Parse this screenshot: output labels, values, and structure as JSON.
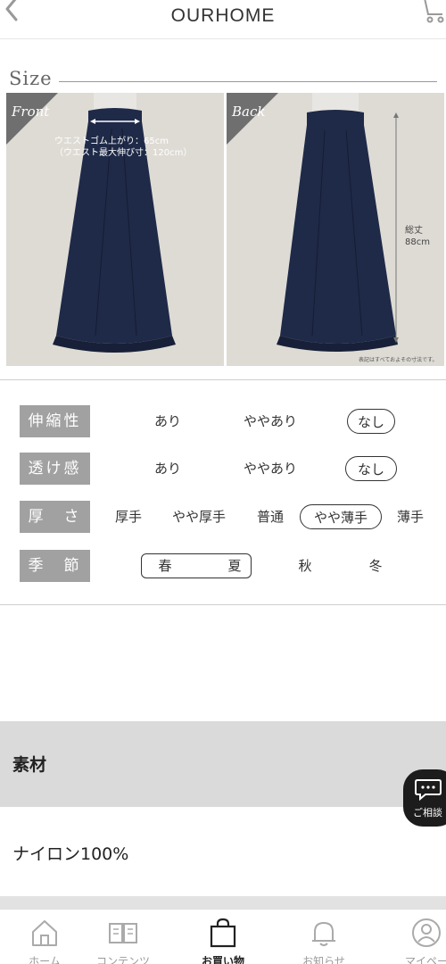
{
  "header": {
    "title": "OURHOME"
  },
  "size_section": {
    "title": "Size",
    "front": {
      "label": "Front",
      "waist_note_1": "ウエストゴム上がり：65cm",
      "waist_note_2": "（ウエスト最大伸び寸：120cm）"
    },
    "back": {
      "label": "Back",
      "length_note_1": "総丈",
      "length_note_2": "88cm",
      "disclaimer": "表記はすべておよその寸法です。"
    }
  },
  "attributes": [
    {
      "label": "伸縮性",
      "options": [
        "あり",
        "ややあり",
        "なし"
      ],
      "selected": "なし"
    },
    {
      "label": "透け感",
      "options": [
        "あり",
        "ややあり",
        "なし"
      ],
      "selected": "なし"
    },
    {
      "label": "厚　さ",
      "options": [
        "厚手",
        "やや厚手",
        "普通",
        "やや薄手",
        "薄手"
      ],
      "selected": "やや薄手"
    },
    {
      "label": "季　節",
      "options": [
        "春",
        "夏",
        "秋",
        "冬"
      ],
      "selected": "春・夏"
    }
  ],
  "material": {
    "title": "素材",
    "value": "ナイロン100%"
  },
  "chat": {
    "label": "ご相談"
  },
  "tabs": [
    {
      "label": "ホーム",
      "icon": "home-icon"
    },
    {
      "label": "コンテンツ",
      "icon": "book-icon"
    },
    {
      "label": "お買い物",
      "icon": "shopping-bag-icon",
      "active": true
    },
    {
      "label": "お知らせ",
      "icon": "bell-icon"
    },
    {
      "label": "マイペー",
      "icon": "user-icon"
    }
  ],
  "colors": {
    "skirt": "#1f2a48",
    "label_bg": "#a1a1a1",
    "photo_bg": "#dedbd4"
  }
}
